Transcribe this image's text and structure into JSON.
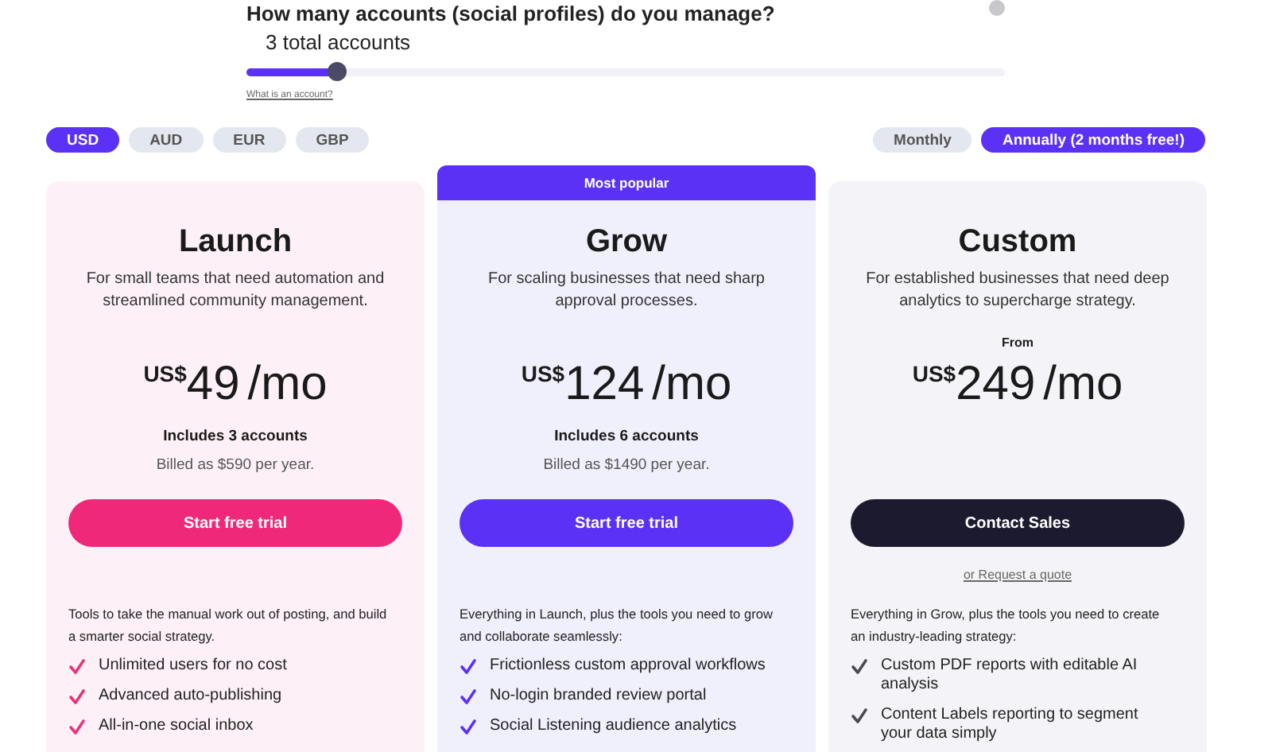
{
  "account_picker": {
    "question": "How many accounts (social profiles) do you manage?",
    "value_label": "3 total accounts",
    "level": 0.12,
    "help_link": "What is an account?"
  },
  "currencies": [
    {
      "label": "USD",
      "selected": true
    },
    {
      "label": "AUD",
      "selected": false
    },
    {
      "label": "EUR",
      "selected": false
    },
    {
      "label": "GBP",
      "selected": false
    }
  ],
  "billing": [
    {
      "label": "Monthly",
      "selected": false
    },
    {
      "label": "Annually (2 months free!)",
      "selected": true
    }
  ],
  "plans": [
    {
      "kind": "starter",
      "name": "Launch",
      "description": "For small teams that need automation and streamlined community management.",
      "currency": "US$",
      "amount": "49",
      "period": "/mo",
      "includes": "Includes 3 accounts",
      "billed": "Billed as $590 per year.",
      "cta": "Start free trial",
      "features_intro": "Tools to take the manual work out of posting, and build a smarter social strategy.",
      "features": [
        "Unlimited users for no cost",
        "Advanced auto-publishing",
        "All-in-one social inbox"
      ]
    },
    {
      "kind": "featured",
      "badge": "Most popular",
      "name": "Grow",
      "description": "For scaling businesses that need sharp approval processes.",
      "currency": "US$",
      "amount": "124",
      "period": "/mo",
      "includes": "Includes 6 accounts",
      "billed": "Billed as $1490 per year.",
      "cta": "Start free trial",
      "features_intro": "Everything in Launch, plus the tools you need to grow and collaborate seamlessly:",
      "features": [
        "Frictionless custom approval workflows",
        "No-login branded review portal",
        "Social Listening audience analytics"
      ]
    },
    {
      "kind": "enterprise",
      "name": "Custom",
      "description": "For established businesses that need deep analytics to supercharge strategy.",
      "price_prefix": "From",
      "currency": "US$",
      "amount": "249",
      "period": "/mo",
      "cta": "Contact Sales",
      "secondary_link": "or Request a quote",
      "features_intro": "Everything in Grow, plus the tools you need to create an industry-leading strategy:",
      "features": [
        "Custom PDF reports with editable AI analysis",
        "Content Labels reporting to segment your data simply"
      ]
    }
  ]
}
